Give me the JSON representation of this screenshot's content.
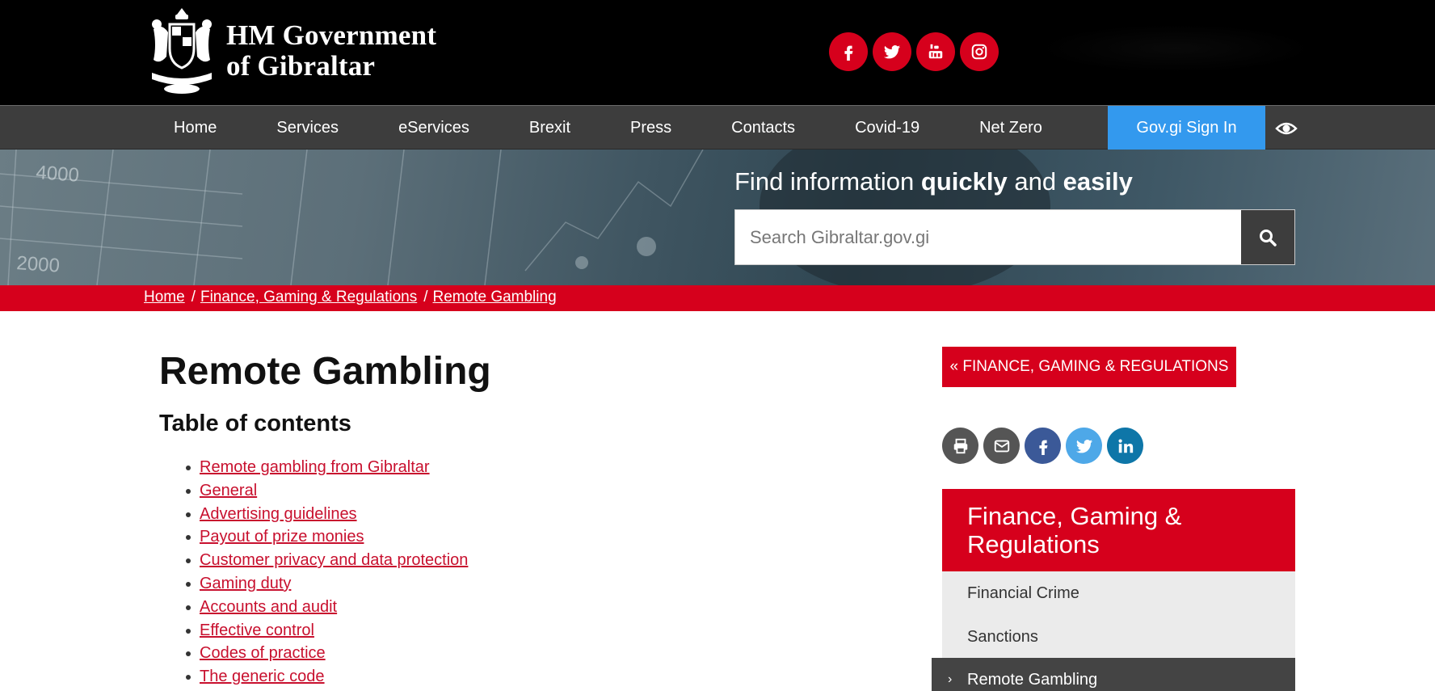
{
  "header": {
    "logo_line1": "HM Government",
    "logo_line2": "of Gibraltar",
    "social": [
      {
        "name": "facebook-icon"
      },
      {
        "name": "twitter-icon"
      },
      {
        "name": "youtube-icon"
      },
      {
        "name": "instagram-icon"
      }
    ],
    "accent_color": "#d6001c"
  },
  "nav": {
    "items": [
      "Home",
      "Services",
      "eServices",
      "Brexit",
      "Press",
      "Contacts",
      "Covid-19",
      "Net Zero"
    ],
    "signin_label": "Gov.gi Sign In",
    "signin_color": "#3399ee"
  },
  "hero": {
    "title_part1": "Find information ",
    "title_bold1": "quickly",
    "title_part2": " and ",
    "title_bold2": "easily",
    "search_placeholder": "Search Gibraltar.gov.gi",
    "bg_label_top": "4000",
    "bg_label_bottom": "2000"
  },
  "breadcrumb": {
    "items": [
      "Home",
      "Finance, Gaming & Regulations",
      "Remote Gambling"
    ],
    "separator": "/"
  },
  "main": {
    "title": "Remote Gambling",
    "toc_title": "Table of contents",
    "toc": [
      "Remote gambling from Gibraltar",
      "General",
      "Advertising guidelines",
      "Payout of prize monies",
      "Customer privacy and data protection",
      "Gaming duty",
      "Accounts and audit",
      "Effective control",
      "Codes of practice",
      "The generic code"
    ]
  },
  "sidebar": {
    "back_label": "FINANCE, GAMING & REGULATIONS",
    "back_chevron": "«",
    "share": [
      {
        "name": "print-icon",
        "color": "#555555"
      },
      {
        "name": "email-icon",
        "color": "#555555"
      },
      {
        "name": "facebook-share-icon",
        "color": "#3b5998"
      },
      {
        "name": "twitter-share-icon",
        "color": "#4ea8e8"
      },
      {
        "name": "linkedin-share-icon",
        "color": "#0e76a8"
      }
    ],
    "section_title": "Finance, Gaming & Regulations",
    "items": [
      "Financial Crime",
      "Sanctions"
    ],
    "active_item": "Remote Gambling",
    "active_chevron": "›"
  }
}
